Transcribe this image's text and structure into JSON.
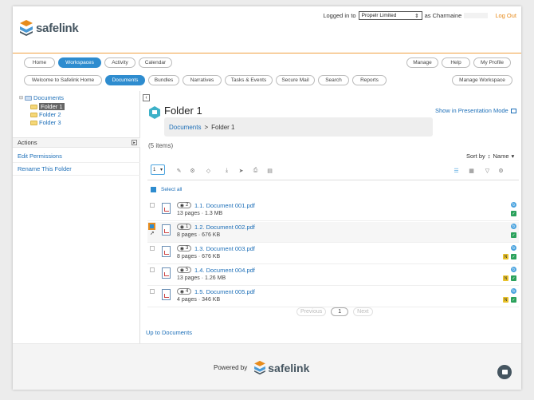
{
  "topbar": {
    "logged_in_label": "Logged in to",
    "org_value": "Propelr Limited",
    "as_label": "as Charmaine",
    "logout": "Log Out"
  },
  "brand": {
    "name": "safelink",
    "powered_by": "Powered by"
  },
  "colors": {
    "accent": "#2e8ccf",
    "brand_orange": "#e78b1c",
    "link": "#1d6fb8"
  },
  "nav_primary": {
    "tabs": [
      "Home",
      "Workspaces",
      "Activity",
      "Calendar"
    ],
    "active": "Workspaces",
    "right": [
      "Manage",
      "Help",
      "My Profile"
    ]
  },
  "nav_secondary": {
    "tabs": [
      "Welcome to Safelink Home",
      "Documents",
      "Bundles",
      "Narratives",
      "Tasks & Events",
      "Secure Mail",
      "Search",
      "Reports"
    ],
    "active": "Documents",
    "right": "Manage Workspace"
  },
  "tree": {
    "root": "Documents",
    "items": [
      "Folder 1",
      "Folder 2",
      "Folder 3"
    ],
    "selected": "Folder 1"
  },
  "actions": {
    "title": "Actions",
    "links": [
      "Edit Permissions",
      "Rename This Folder"
    ]
  },
  "folder": {
    "title": "Folder 1",
    "presentation": "Show in Presentation Mode",
    "breadcrumb": [
      "Documents",
      ">",
      "Folder 1"
    ],
    "count": "(5 items)",
    "sort_label": "Sort by",
    "sort_value": "Name",
    "page_select": "1",
    "select_all": "Select all"
  },
  "documents": [
    {
      "badge": "2",
      "name": "1.1. Document 001.pdf",
      "pages": "13 pages",
      "size": "1.3 MB",
      "checked": false,
      "yellow": false
    },
    {
      "badge": "1",
      "name": "1.2. Document 002.pdf",
      "pages": "8 pages",
      "size": "676 KB",
      "checked": true,
      "yellow": false
    },
    {
      "badge": "3",
      "name": "1.3. Document 003.pdf",
      "pages": "8 pages",
      "size": "676 KB",
      "checked": false,
      "yellow": true
    },
    {
      "badge": "5",
      "name": "1.4. Document 004.pdf",
      "pages": "13 pages",
      "size": "1.26 MB",
      "checked": false,
      "yellow": true
    },
    {
      "badge": "4",
      "name": "1.5. Document 005.pdf",
      "pages": "4 pages",
      "size": "346 KB",
      "checked": false,
      "yellow": true
    }
  ],
  "pagination": {
    "prev": "Previous",
    "current": "1",
    "next": "Next"
  },
  "up_link": "Up to Documents",
  "icons": {
    "toolbar": [
      "pencil-icon",
      "gear-icon",
      "tag-icon",
      "download-icon",
      "send-icon",
      "print-icon",
      "move-icon"
    ],
    "view": [
      "list-view-icon",
      "grid-view-icon",
      "filter-icon",
      "settings-icon"
    ]
  }
}
